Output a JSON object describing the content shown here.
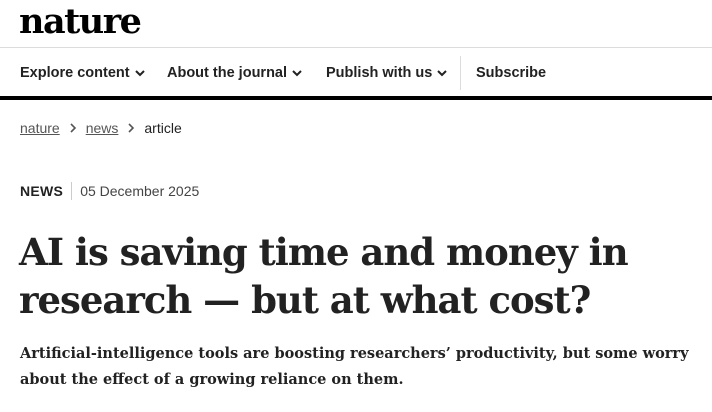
{
  "header": {
    "logo": "nature"
  },
  "nav": {
    "items": [
      {
        "label": "Explore content"
      },
      {
        "label": "About the journal"
      },
      {
        "label": "Publish with us"
      }
    ],
    "subscribe": "Subscribe"
  },
  "breadcrumb": {
    "items": [
      "nature",
      "news"
    ],
    "current": "article"
  },
  "article": {
    "type": "NEWS",
    "date": "05 December 2025",
    "title_line1": "AI is saving time and money in",
    "title_line2": "research — but at what cost?",
    "standfirst_line1": "Artificial-intelligence tools are boosting researchers’ productivity, but some worry",
    "standfirst_line2": "about the effect of a growing reliance on them."
  }
}
